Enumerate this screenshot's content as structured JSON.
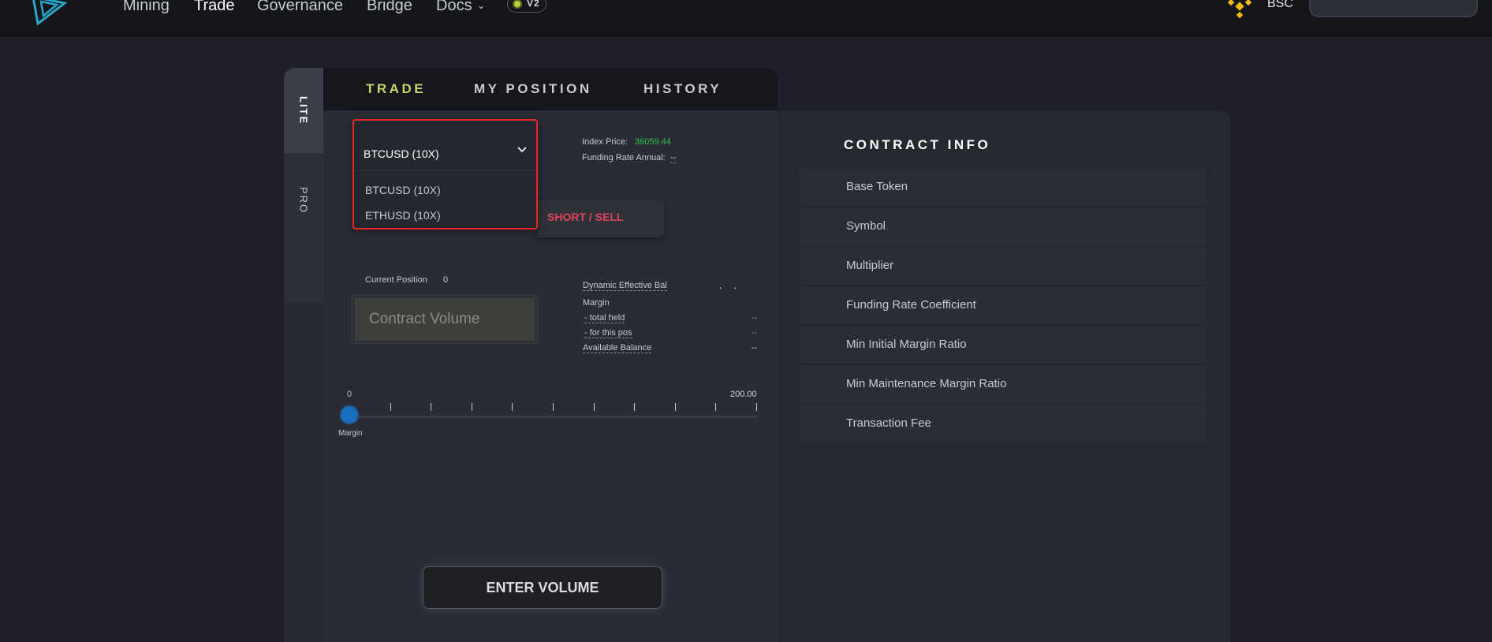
{
  "nav": {
    "items": [
      "Mining",
      "Trade",
      "Governance",
      "Bridge",
      "Docs"
    ],
    "active": "Trade",
    "version_badge": "V2",
    "network": "BSC"
  },
  "side_tabs": [
    "LITE",
    "PRO"
  ],
  "tabs": [
    "TRADE",
    "MY POSITION",
    "HISTORY"
  ],
  "pair_select": {
    "current": "BTCUSD (10X)",
    "options": [
      "BTCUSD (10X)",
      "ETHUSD (10X)"
    ]
  },
  "short_button": "SHORT / SELL",
  "index_price": {
    "label": "Index Price:",
    "value": "36059.44"
  },
  "funding_rate": {
    "label": "Funding Rate Annual:",
    "value": "--"
  },
  "current_position": {
    "label": "Current Position",
    "value": "0"
  },
  "volume_input": {
    "placeholder": "Contract Volume"
  },
  "account": {
    "dynamic_label": "Dynamic Effective Bal",
    "margin_label": "Margin",
    "total_held_label": "- total held",
    "total_held_value": "--",
    "for_this_pos_label": "- for this pos",
    "for_this_pos_value": "--",
    "available_label": "Available Balance",
    "available_value": "--"
  },
  "slider": {
    "min": "0",
    "max": "200.00",
    "caption": "Margin",
    "value_fraction": 0
  },
  "submit_button": "ENTER VOLUME",
  "contract_info": {
    "title": "CONTRACT INFO",
    "rows": [
      "Base Token",
      "Symbol",
      "Multiplier",
      "Funding Rate Coefficient",
      "Min Initial Margin Ratio",
      "Min Maintenance Margin Ratio",
      "Transaction Fee"
    ]
  },
  "colors": {
    "accent_tab": "#c4d66a",
    "short": "#e0435b",
    "index_price": "#2ec24a",
    "slider_thumb": "#1b6fc0",
    "highlight_border": "#e02a2a"
  }
}
